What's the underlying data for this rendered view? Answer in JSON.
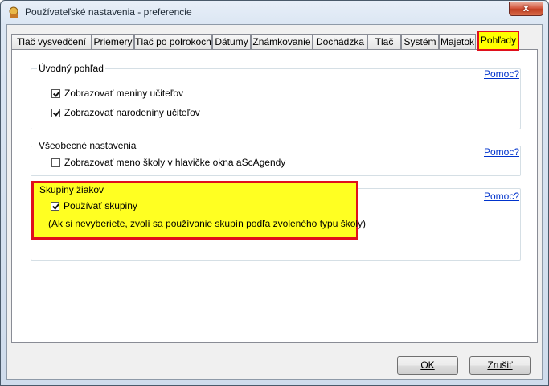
{
  "window": {
    "title": "Používateľské nastavenia - preferencie",
    "close_symbol": "x"
  },
  "tabs": [
    {
      "label": "Tlač vysvedčení"
    },
    {
      "label": "Priemery"
    },
    {
      "label": "Tlač po polrokoch"
    },
    {
      "label": "Dátumy"
    },
    {
      "label": "Známkovanie"
    },
    {
      "label": "Dochádzka"
    },
    {
      "label": "Tlač"
    },
    {
      "label": "Systém"
    },
    {
      "label": "Majetok"
    },
    {
      "label": "Pohľady"
    }
  ],
  "groups": {
    "intro_view": {
      "title": "Úvodný pohľad",
      "help": "Pomoc?",
      "options": [
        {
          "label": "Zobrazovať meniny učiteľov",
          "checked": true
        },
        {
          "label": "Zobrazovať narodeniny učiteľov",
          "checked": true
        }
      ]
    },
    "general": {
      "title": "Všeobecné nastavenia",
      "help": "Pomoc?",
      "options": [
        {
          "label": "Zobrazovať meno školy v hlavičke okna aScAgendy",
          "checked": false
        }
      ]
    },
    "student_groups": {
      "title": "Skupiny žiakov",
      "help": "Pomoc?",
      "options": [
        {
          "label": "Používať skupiny",
          "checked": true
        }
      ],
      "note": "(Ak si nevyberiete, zvolí sa používanie skupín podľa zvoleného typu školy)"
    }
  },
  "buttons": {
    "ok": "OK",
    "cancel": "Zrušiť"
  },
  "colors": {
    "highlight_fill": "#ffff22",
    "highlight_border": "#e0101c",
    "link": "#0033cc"
  }
}
